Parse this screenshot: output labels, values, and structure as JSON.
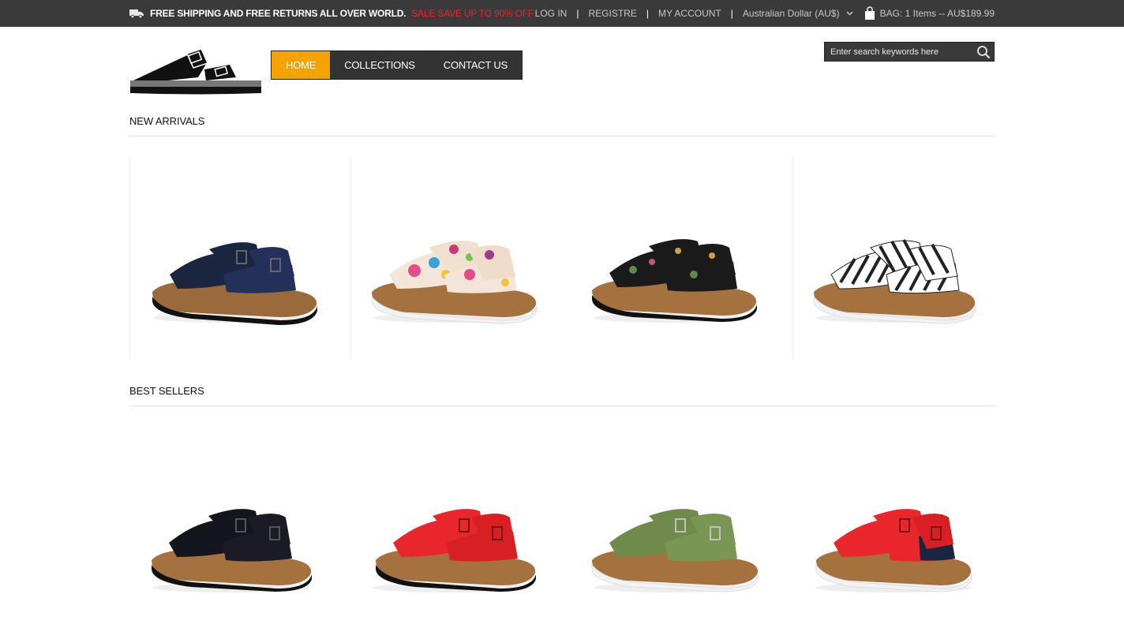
{
  "topbar": {
    "promo_text": "FREE SHIPPING AND FREE RETURNS ALL OVER WORLD.",
    "sale_text": "SALE SAVE UP TO 90% OFF",
    "login": "LOG IN",
    "register": "REGISTRE",
    "account": "MY ACCOUNT",
    "currency": "Australian Dollar (AU$)",
    "bag": "BAG: 1 Items -- AU$189.99",
    "separator": "|"
  },
  "nav": {
    "items": [
      {
        "label": "HOME",
        "active": true
      },
      {
        "label": "COLLECTIONS",
        "active": false
      },
      {
        "label": "CONTACT US",
        "active": false
      }
    ]
  },
  "search": {
    "placeholder": "Enter search keywords here"
  },
  "sections": {
    "new_arrivals": {
      "title": "NEW ARRIVALS",
      "products": [
        {
          "color": "navy",
          "icon": "sandal-navy"
        },
        {
          "color": "floral",
          "icon": "sandal-floral"
        },
        {
          "color": "black-floral",
          "icon": "sandal-black-floral"
        },
        {
          "color": "zebra",
          "icon": "sandal-zebra"
        }
      ]
    },
    "best_sellers": {
      "title": "BEST SELLERS",
      "products": [
        {
          "color": "black",
          "icon": "sandal-black"
        },
        {
          "color": "red",
          "icon": "sandal-red"
        },
        {
          "color": "olive",
          "icon": "sandal-olive"
        },
        {
          "color": "red-navy",
          "icon": "sandal-red-navy"
        }
      ]
    }
  },
  "colors": {
    "topbar_bg": "#3a3a3a",
    "accent": "#f5a300",
    "sale": "#e8262b",
    "nav_bg": "#333333"
  }
}
